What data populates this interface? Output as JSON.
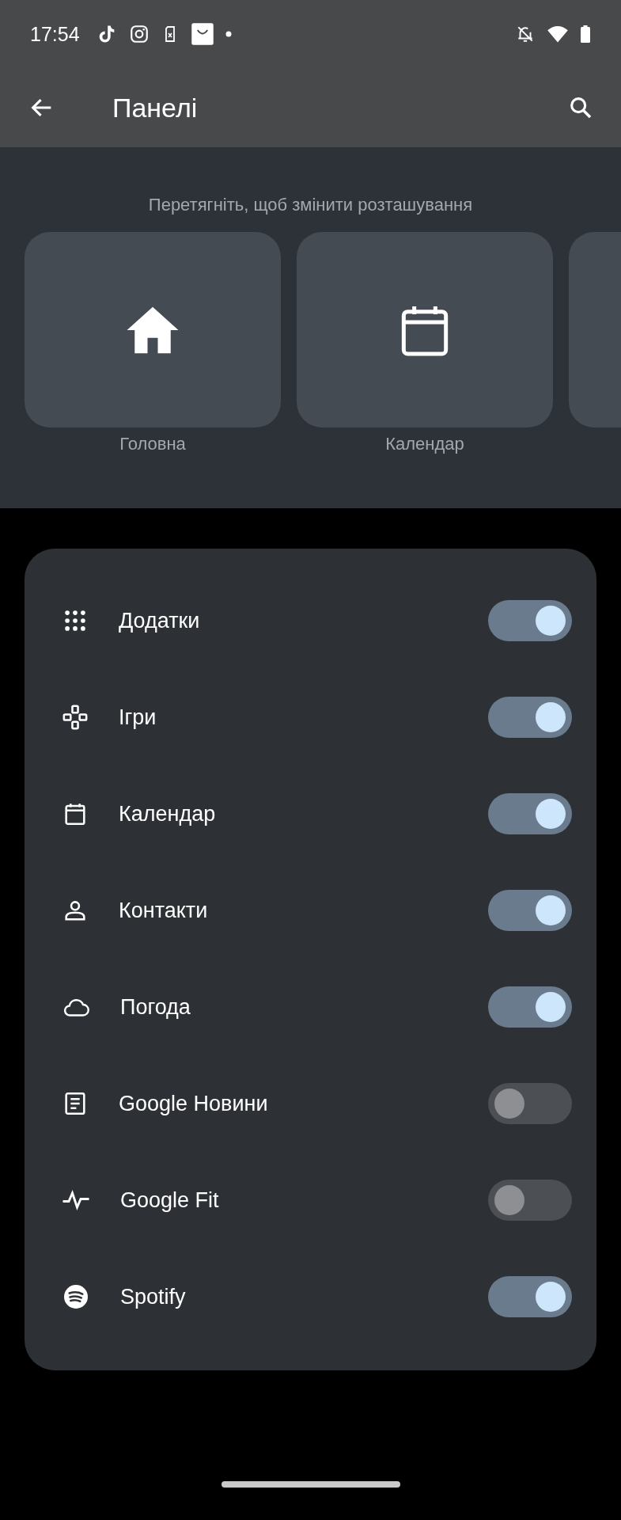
{
  "status_bar": {
    "time": "17:54"
  },
  "app_bar": {
    "title": "Панелі"
  },
  "panels": {
    "hint": "Перетягніть, щоб змінити розташування",
    "tiles": [
      {
        "label": "Головна"
      },
      {
        "label": "Календар"
      }
    ]
  },
  "toggles": [
    {
      "label": "Додатки",
      "on": true
    },
    {
      "label": "Ігри",
      "on": true
    },
    {
      "label": "Календар",
      "on": true
    },
    {
      "label": "Контакти",
      "on": true
    },
    {
      "label": "Погода",
      "on": true
    },
    {
      "label": "Google Новини",
      "on": false
    },
    {
      "label": "Google Fit",
      "on": false
    },
    {
      "label": "Spotify",
      "on": true
    }
  ]
}
